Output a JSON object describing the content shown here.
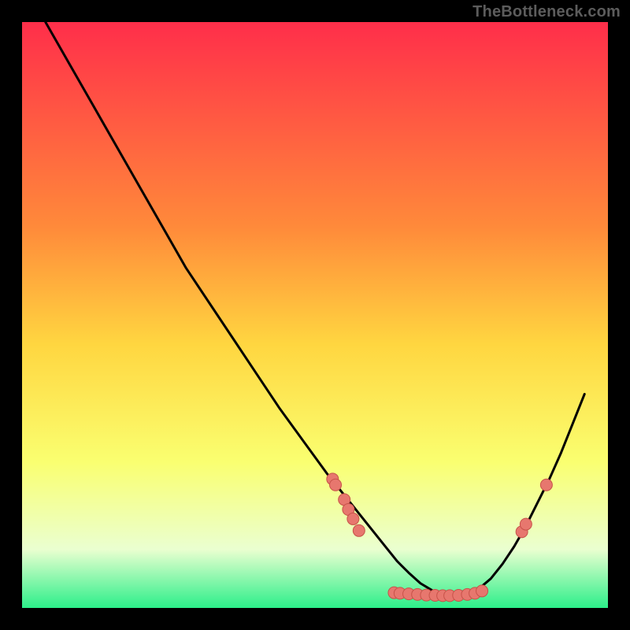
{
  "attribution": "TheBottleneck.com",
  "colors": {
    "gradient_top": "#ff2e4a",
    "gradient_mid_upper": "#ff8a3a",
    "gradient_mid": "#ffd640",
    "gradient_mid_lower": "#faff70",
    "gradient_low": "#eaffd0",
    "gradient_bottom": "#2cef8a",
    "curve": "#000000",
    "marker": "#e7776e",
    "marker_stroke": "#c75249"
  },
  "chart_data": {
    "type": "line",
    "title": "",
    "xlabel": "",
    "ylabel": "",
    "xlim": [
      0,
      100
    ],
    "ylim": [
      0,
      100
    ],
    "curve": {
      "x": [
        4,
        8,
        12,
        16,
        20,
        24,
        28,
        32,
        36,
        40,
        44,
        48,
        52,
        56,
        58,
        60,
        62,
        64,
        66,
        68,
        70,
        72,
        74,
        76,
        78,
        80,
        82,
        84,
        86,
        88,
        90,
        92,
        94,
        96
      ],
      "y": [
        100,
        93,
        86,
        79,
        72,
        65,
        58,
        52,
        46,
        40,
        34,
        28.5,
        23,
        18,
        15.5,
        13,
        10.5,
        8,
        6,
        4.2,
        3,
        2.2,
        2,
        2.3,
        3.3,
        5,
        7.5,
        10.5,
        14,
        18,
        22,
        26.5,
        31.5,
        36.5
      ]
    },
    "markers": [
      {
        "x": 53,
        "y": 22
      },
      {
        "x": 53.5,
        "y": 21
      },
      {
        "x": 55,
        "y": 18.5
      },
      {
        "x": 55.7,
        "y": 16.8
      },
      {
        "x": 56.5,
        "y": 15.2
      },
      {
        "x": 57.5,
        "y": 13.2
      },
      {
        "x": 63.5,
        "y": 2.6
      },
      {
        "x": 64.5,
        "y": 2.5
      },
      {
        "x": 66,
        "y": 2.4
      },
      {
        "x": 67.5,
        "y": 2.3
      },
      {
        "x": 69,
        "y": 2.2
      },
      {
        "x": 70.5,
        "y": 2.15
      },
      {
        "x": 71.8,
        "y": 2.1
      },
      {
        "x": 73,
        "y": 2.1
      },
      {
        "x": 74.5,
        "y": 2.15
      },
      {
        "x": 76,
        "y": 2.3
      },
      {
        "x": 77.3,
        "y": 2.5
      },
      {
        "x": 78.5,
        "y": 2.9
      },
      {
        "x": 85.3,
        "y": 13
      },
      {
        "x": 86,
        "y": 14.3
      },
      {
        "x": 89.5,
        "y": 21
      }
    ]
  }
}
